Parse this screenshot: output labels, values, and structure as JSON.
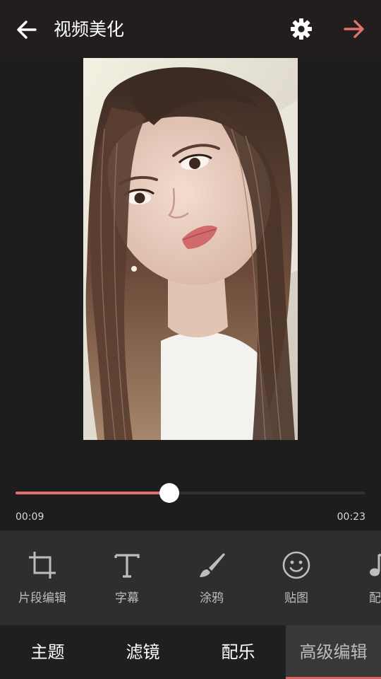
{
  "header": {
    "title": "视频美化",
    "back_icon": "arrow-left-icon",
    "settings_icon": "gear-icon",
    "next_icon": "arrow-right-icon",
    "next_color": "#e0736b"
  },
  "preview": {
    "content": "portrait photo of a woman with long brown hair"
  },
  "player": {
    "current_time": "00:09",
    "total_time": "00:23",
    "progress": 0.44,
    "accent": "#e0736b"
  },
  "tools": [
    {
      "label": "片段编辑",
      "icon": "crop-icon"
    },
    {
      "label": "字幕",
      "icon": "text-icon"
    },
    {
      "label": "涂鸦",
      "icon": "brush-icon"
    },
    {
      "label": "贴图",
      "icon": "smiley-icon"
    },
    {
      "label": "配乐",
      "icon": "music-note-icon"
    }
  ],
  "tabs": [
    {
      "label": "主题",
      "active": false
    },
    {
      "label": "滤镜",
      "active": false
    },
    {
      "label": "配乐",
      "active": false
    },
    {
      "label": "高级编辑",
      "active": true
    }
  ]
}
